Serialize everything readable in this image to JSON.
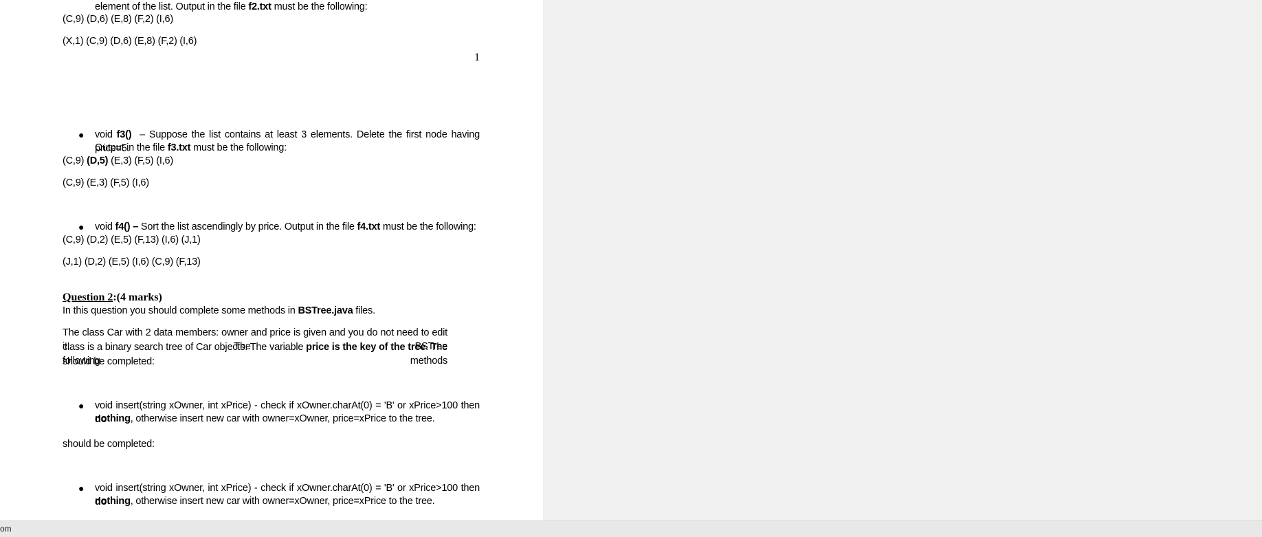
{
  "doc": {
    "l1a": "element of  the  list. Output in the file ",
    "l1b": "f2.txt",
    "l1c": " must be the following:",
    "l2": "(C,9) (D,6) (E,8) (F,2) (I,6)",
    "l3": "(X,1) (C,9) (D,6) (E,8) (F,2) (I,6)",
    "pagenum": "1",
    "f3_a": "void ",
    "f3_b": "f3()",
    "f3_c": " – Suppose the list contains at least 3 elements. Delete the first node having price=5.",
    "f3_d": "Output in the file ",
    "f3_e": "f3.txt",
    "f3_f": " must be the following:",
    "f3_in_a": "(C,9) ",
    "f3_in_b": "(D,5)",
    "f3_in_c": " (E,3) (F,5) (I,6)",
    "f3_out": "(C,9) (E,3) (F,5) (I,6)",
    "f4_a": "void ",
    "f4_b": "f4() –",
    "f4_c": " Sort the list ascendingly by price. Output in the file ",
    "f4_d": "f4.txt",
    "f4_e": " must be the following:",
    "f4_in": "(C,9) (D,2) (E,5) (F,13) (I,6) (J,1)",
    "f4_out": "(J,1) (D,2) (E,5) (I,6) (C,9) (F,13)",
    "q2_title": "Question 2",
    "q2_marks": ":(4 marks)",
    "q2_intro_a": "In this question you should complete some methods in  ",
    "q2_intro_b": "BSTree.java",
    "q2_intro_c": " files.",
    "p1": "The class Car with 2 data members: owner and price is given and you do not need to edit it. The BSTree",
    "p2a": "class is a binary search tree of  Car objects. The variable ",
    "p2b": "price is the key of the tree",
    "p2c": ". The following methods",
    "p3": "should be completed:",
    "ins1a": "void insert(string xOwner, int xPrice) - check if xOwner.charAt(0) = 'B' or xPrice>100    then ",
    "ins1b": "do",
    "ins2a": "nothing",
    "ins2b": ", otherwise insert new car with owner=xOwner, price=xPrice to the tree.",
    "p4": "should be completed:",
    "ins3a": "void insert(string xOwner, int xPrice) - check if xOwner.charAt(0) = 'B' or xPrice>100    then ",
    "ins3b": "do",
    "ins4a": "nothing",
    "ins4b": ", otherwise insert new car with owner=xOwner, price=xPrice to the tree."
  },
  "status": {
    "text": "om"
  }
}
